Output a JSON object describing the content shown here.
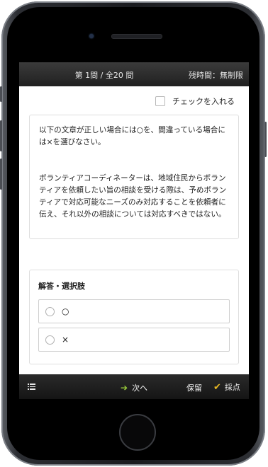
{
  "topbar": {
    "progress": "第 1問 / 全20 問",
    "time": "残時間：無制限"
  },
  "check": {
    "label": "チェックを入れる"
  },
  "question": {
    "instruction": "以下の文章が正しい場合には○を、間違っている場合には×を選びなさい。",
    "body": "ボランティアコーディネーターは、地域住民からボランティアを依頼したい旨の相談を受ける際は、予めボランティアで対応可能なニーズのみ対応することを依頼者に伝え、それ以外の相談については対応すべきではない。"
  },
  "answer": {
    "title": "解答・選択肢",
    "options": [
      {
        "label": "○"
      },
      {
        "label": "×"
      }
    ]
  },
  "bottombar": {
    "next": "次へ",
    "hold": "保留",
    "score": "採点"
  },
  "colors": {
    "accent_arrow": "#9ccf3c",
    "accent_check": "#e8b823",
    "bar": "#202020"
  },
  "icons": {
    "menu": "list-menu-icon",
    "next": "arrow-right-icon",
    "score": "checkmark-icon"
  }
}
